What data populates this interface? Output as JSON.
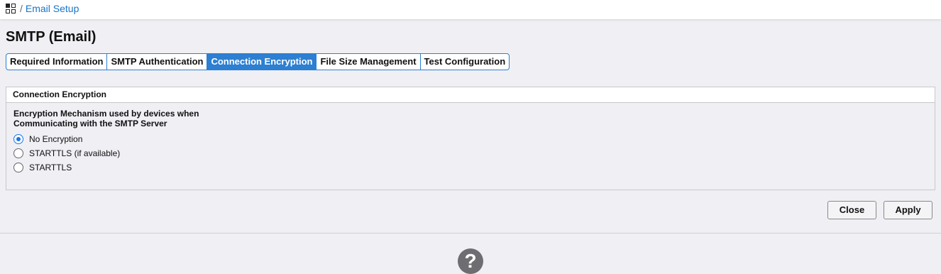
{
  "breadcrumb": {
    "icon": "apps-grid-icon",
    "separator": "/",
    "current": "Email Setup"
  },
  "page_title": "SMTP (Email)",
  "tabs": [
    {
      "label": "Required Information",
      "active": false
    },
    {
      "label": "SMTP Authentication",
      "active": false
    },
    {
      "label": "Connection Encryption",
      "active": true
    },
    {
      "label": "File Size Management",
      "active": false
    },
    {
      "label": "Test Configuration",
      "active": false
    }
  ],
  "panel": {
    "title": "Connection Encryption",
    "description_line1": "Encryption Mechanism used by devices when",
    "description_line2": "Communicating with the SMTP Server",
    "options": [
      {
        "label": "No Encryption",
        "checked": true
      },
      {
        "label": "STARTTLS (if available)",
        "checked": false
      },
      {
        "label": "STARTTLS",
        "checked": false
      }
    ]
  },
  "buttons": {
    "close": "Close",
    "apply": "Apply"
  },
  "help": {
    "icon": "help-icon",
    "glyph": "?"
  },
  "colors": {
    "accent": "#2d7fd1",
    "radio": "#1a73e8",
    "link": "#1a73c8"
  }
}
